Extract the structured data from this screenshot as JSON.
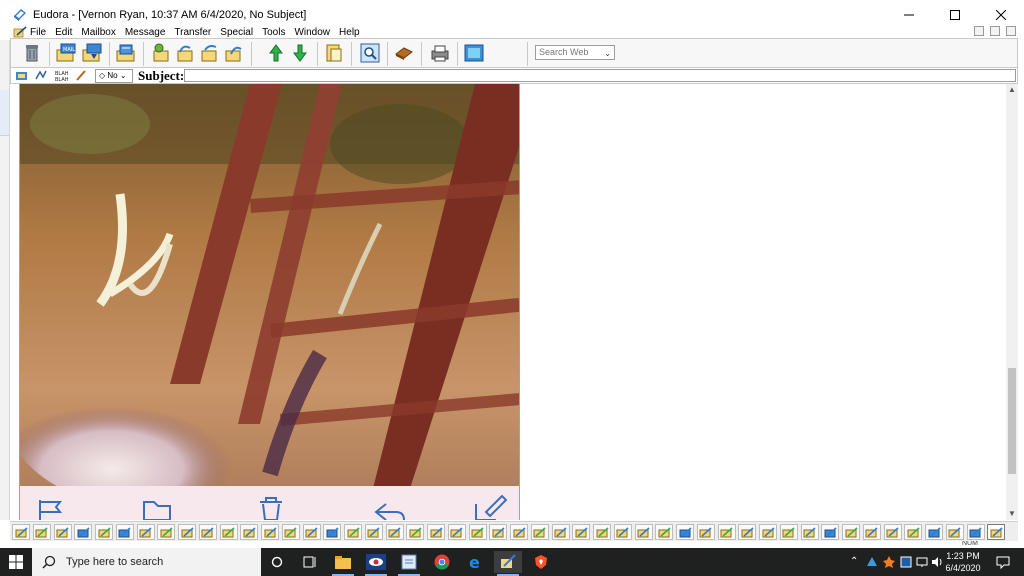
{
  "window": {
    "title": "Eudora - [Vernon Ryan, 10:37 AM 6/4/2020, No Subject]"
  },
  "menu": {
    "items": [
      "File",
      "Edit",
      "Mailbox",
      "Message",
      "Transfer",
      "Special",
      "Tools",
      "Window",
      "Help"
    ]
  },
  "toolbar": {
    "search_value": "Search Web",
    "icons": [
      "trash-icon",
      "check-mail-icon",
      "send-mail-icon",
      "compose-icon",
      "reply-icon",
      "reply-all-icon",
      "forward-icon",
      "redirect-icon",
      "next-message-icon",
      "previous-message-icon",
      "attach-icon",
      "find-icon",
      "address-book-icon",
      "print-icon",
      "help-icon"
    ]
  },
  "compose": {
    "priority_value": "No",
    "subject_label": "Subject:",
    "subject_value": ""
  },
  "indicator": {
    "num": "NUM"
  },
  "tabstrip": {
    "count": 48
  },
  "taskbar": {
    "search_placeholder": "Type here to search",
    "clock_time": "1:23 PM",
    "clock_date": "6/4/2020",
    "pinned": [
      "task-view-icon",
      "file-explorer-icon",
      "eye-app-icon",
      "notepad-icon",
      "chrome-icon",
      "edge-icon",
      "eudora-icon",
      "brave-icon"
    ]
  },
  "colors": {
    "taskbar_bg": "#1f2020",
    "accent": "#0a64c8"
  }
}
